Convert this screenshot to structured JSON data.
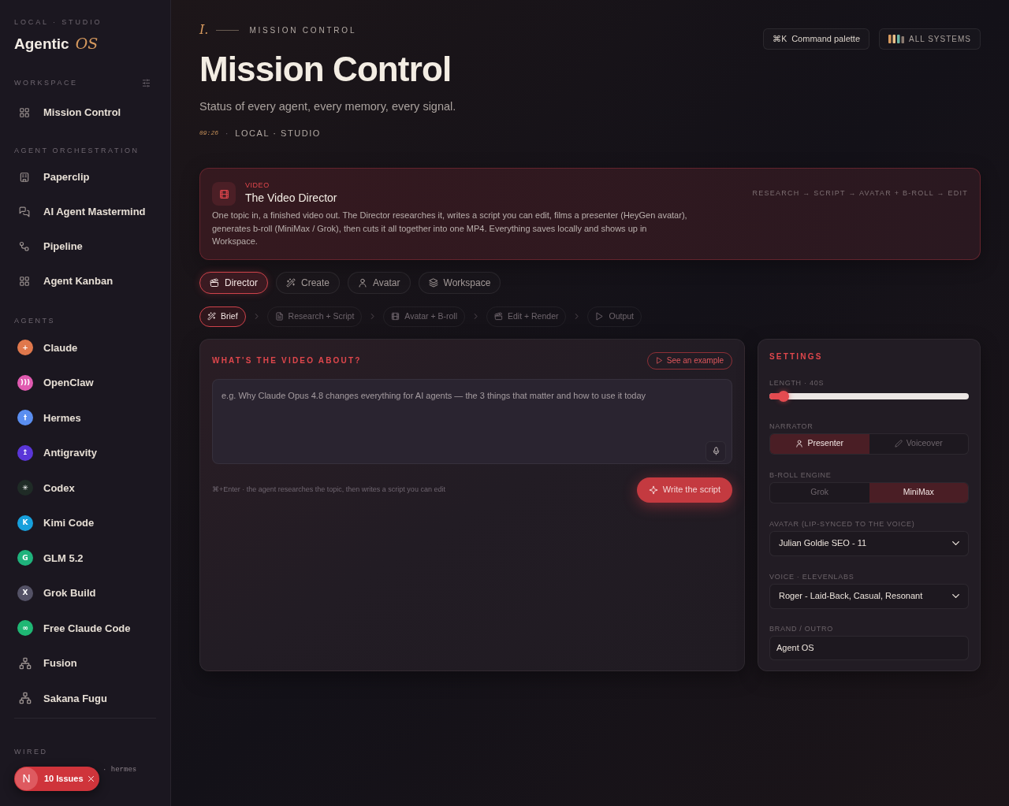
{
  "sidebar": {
    "eyebrow": "LOCAL · STUDIO",
    "brand": "Agentic",
    "brand_accent": "OS",
    "workspace": {
      "title": "WORKSPACE",
      "items": [
        {
          "label": "Mission Control",
          "kind": "grid"
        }
      ]
    },
    "orchestration": {
      "title": "AGENT ORCHESTRATION",
      "items": [
        {
          "label": "Paperclip",
          "kind": "building"
        },
        {
          "label": "AI Agent Mastermind",
          "kind": "chat"
        },
        {
          "label": "Pipeline",
          "kind": "flow"
        },
        {
          "label": "Agent Kanban",
          "kind": "grid"
        }
      ]
    },
    "agents": {
      "title": "AGENTS",
      "items": [
        {
          "label": "Claude",
          "kind": "logo",
          "color": "#e0784c",
          "glyph": "+"
        },
        {
          "label": "OpenClaw",
          "kind": "logo",
          "color": "#e05ab0",
          "glyph": ")))"
        },
        {
          "label": "Hermes",
          "kind": "logo",
          "color": "#5a8ef0",
          "glyph": "†"
        },
        {
          "label": "Antigravity",
          "kind": "logo",
          "color": "#5a36d8",
          "glyph": "↥"
        },
        {
          "label": "Codex",
          "kind": "logo",
          "color": "#1f2b26",
          "glyph": "✳"
        },
        {
          "label": "Kimi Code",
          "kind": "logo",
          "color": "#17a0dc",
          "glyph": "K"
        },
        {
          "label": "GLM 5.2",
          "kind": "logo",
          "color": "#1fb37c",
          "glyph": "G"
        },
        {
          "label": "Grok Build",
          "kind": "logo",
          "color": "#545266",
          "glyph": "X"
        },
        {
          "label": "Free Claude Code",
          "kind": "logo",
          "color": "#1fb774",
          "glyph": "∞"
        },
        {
          "label": "Fusion",
          "kind": "network"
        },
        {
          "label": "Sakana Fugu",
          "kind": "network"
        }
      ]
    },
    "wired": {
      "title": "WIRED",
      "text": "· hermes"
    }
  },
  "header": {
    "numeral": "I.",
    "eyebrow": "MISSION CONTROL",
    "title": "Mission Control",
    "subtitle": "Status of every agent, every memory, every signal.",
    "time": "09:26",
    "separator": "·",
    "location": "LOCAL · STUDIO",
    "actions": [
      {
        "kind": "shortcut",
        "key": "⌘K",
        "label": "Command palette"
      },
      {
        "kind": "status",
        "label": "ALL SYSTEMS"
      }
    ]
  },
  "hero": {
    "tag": "VIDEO",
    "title": "The Video Director",
    "flow": "RESEARCH → SCRIPT → AVATAR + B-ROLL → EDIT",
    "description": "One topic in, a finished video out. The Director researches it, writes a script you can edit, films a presenter (HeyGen avatar), generates b-roll (MiniMax / Grok), then cuts it all together into one MP4. Everything saves locally and shows up in Workspace."
  },
  "tabs": [
    {
      "label": "Director",
      "kind": "clapper",
      "selected": true
    },
    {
      "label": "Create",
      "kind": "wand",
      "selected": false
    },
    {
      "label": "Avatar",
      "kind": "person",
      "selected": false
    },
    {
      "label": "Workspace",
      "kind": "layers",
      "selected": false
    }
  ],
  "steps": [
    {
      "label": "Brief",
      "kind": "wand",
      "selected": true
    },
    {
      "label": "Research + Script",
      "kind": "doc",
      "selected": false
    },
    {
      "label": "Avatar + B-roll",
      "kind": "film",
      "selected": false
    },
    {
      "label": "Edit + Render",
      "kind": "clapper",
      "selected": false
    },
    {
      "label": "Output",
      "kind": "play",
      "selected": false
    }
  ],
  "brief": {
    "title": "WHAT'S THE VIDEO ABOUT?",
    "example_button": "See an example",
    "topic": {
      "placeholder": "e.g. Why Claude Opus 4.8 changes everything for AI agents — the 3 things that matter and how to use it today"
    },
    "hint": "⌘+Enter · the agent researches the topic, then writes a script you can edit",
    "submit": "Write the script"
  },
  "settings": {
    "title": "SETTINGS",
    "length": {
      "label": "LENGTH · 40S",
      "level": 0.07
    },
    "narrator": {
      "label": "NARRATOR",
      "options": [
        {
          "label": "Presenter",
          "kind": "person",
          "selected": true
        },
        {
          "label": "Voiceover",
          "kind": "pen",
          "selected": false
        }
      ]
    },
    "broll": {
      "label": "B-ROLL ENGINE",
      "options": [
        {
          "label": "Grok",
          "selected": false
        },
        {
          "label": "MiniMax",
          "selected": true
        }
      ]
    },
    "avatar": {
      "label": "AVATAR (LIP-SYNCED TO THE VOICE)",
      "value": "Julian Goldie SEO - 11"
    },
    "voice": {
      "label": "VOICE · ELEVENLABS",
      "value": "Roger - Laid-Back, Casual, Resonant"
    },
    "brand": {
      "label": "BRAND / OUTRO",
      "value": "Agent OS"
    }
  },
  "issues_badge": {
    "logo": "N",
    "label": "10 Issues"
  }
}
